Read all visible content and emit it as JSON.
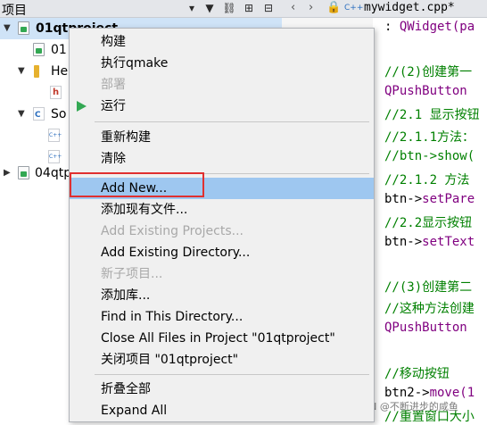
{
  "project_panel": {
    "title": "项目",
    "tree": {
      "project1": "01qtproject",
      "project1_file": "01",
      "headers": "He",
      "sources": "So",
      "project2": "04qtp"
    }
  },
  "editor": {
    "tab_name": "mywidget.cpp*",
    "lines": [
      ": QWidget(pa",
      "",
      "//(2)创建第一",
      "QPushButton",
      "//2.1 显示按钮",
      "//2.1.1方法：",
      "//btn->show(",
      "//2.1.2 方法",
      "btn->setPare",
      "//2.2显示按钮",
      "btn->setText",
      "",
      "//(3)创建第二",
      "//这种方法创建",
      "QPushButton",
      "",
      "//移动按钮",
      "btn2->move(1",
      "//重置窗口大小"
    ]
  },
  "context_menu": {
    "items": [
      {
        "label": "构建",
        "disabled": false
      },
      {
        "label": "执行qmake",
        "disabled": false
      },
      {
        "label": "部署",
        "disabled": true
      },
      {
        "label": "运行",
        "disabled": false
      },
      {
        "label": "重新构建",
        "disabled": false
      },
      {
        "label": "清除",
        "disabled": false
      },
      {
        "label": "Add New...",
        "disabled": false
      },
      {
        "label": "添加现有文件...",
        "disabled": false
      },
      {
        "label": "Add Existing Projects...",
        "disabled": true
      },
      {
        "label": "Add Existing Directory...",
        "disabled": false
      },
      {
        "label": "新子项目...",
        "disabled": true
      },
      {
        "label": "添加库...",
        "disabled": false
      },
      {
        "label": "Find in This Directory...",
        "disabled": false
      },
      {
        "label": "Close All Files in Project \"01qtproject\"",
        "disabled": false
      },
      {
        "label": "关闭项目 \"01qtproject\"",
        "disabled": false
      },
      {
        "label": "折叠全部",
        "disabled": false
      },
      {
        "label": "Expand All",
        "disabled": false
      }
    ]
  },
  "watermark": "CSDN @不断进步的咸鱼",
  "colors": {
    "highlight": "#9ec7f0",
    "annotation_box": "#e03030",
    "comment": "#008000",
    "type": "#800080"
  }
}
